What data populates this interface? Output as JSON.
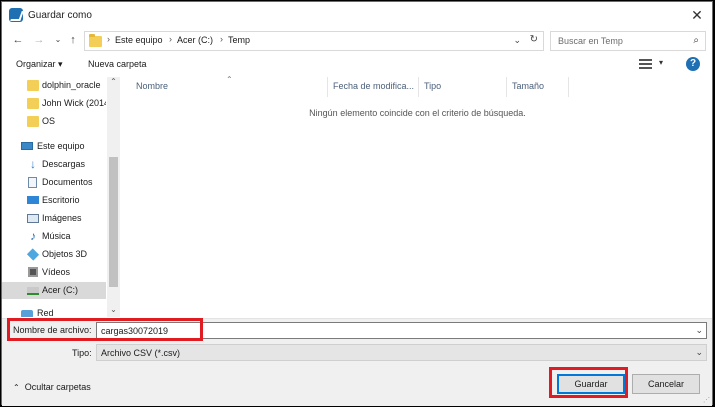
{
  "window": {
    "title": "Guardar como"
  },
  "nav": {
    "breadcrumb": [
      "Este equipo",
      "Acer (C:)",
      "Temp"
    ],
    "search_placeholder": "Buscar en Temp"
  },
  "toolbar": {
    "organize": "Organizar ▾",
    "new_folder": "Nueva carpeta",
    "help": "?"
  },
  "sidebar": {
    "items": [
      {
        "label": "dolphin_oracle",
        "icon": "folder-icon"
      },
      {
        "label": "John Wick (2014",
        "icon": "folder-icon"
      },
      {
        "label": "OS",
        "icon": "folder-icon"
      },
      {
        "label": "Este equipo",
        "icon": "computer-icon"
      },
      {
        "label": "Descargas",
        "icon": "downloads-icon"
      },
      {
        "label": "Documentos",
        "icon": "documents-icon"
      },
      {
        "label": "Escritorio",
        "icon": "desktop-icon"
      },
      {
        "label": "Imágenes",
        "icon": "pictures-icon"
      },
      {
        "label": "Música",
        "icon": "music-icon"
      },
      {
        "label": "Objetos 3D",
        "icon": "objects3d-icon"
      },
      {
        "label": "Vídeos",
        "icon": "videos-icon"
      },
      {
        "label": "Acer (C:)",
        "icon": "drive-icon"
      },
      {
        "label": "Red",
        "icon": "network-icon"
      }
    ]
  },
  "filelist": {
    "columns": [
      "Nombre",
      "Fecha de modifica...",
      "Tipo",
      "Tamaño"
    ],
    "empty_message": "Ningún elemento coincide con el criterio de búsqueda."
  },
  "form": {
    "filename_label": "Nombre de archivo:",
    "filename_value": "cargas30072019",
    "type_label": "Tipo:",
    "type_value": "Archivo CSV (*.csv)"
  },
  "footer": {
    "hide_folders": "Ocultar carpetas",
    "save": "Guardar",
    "cancel": "Cancelar"
  },
  "colors": {
    "accent": "#0078d7",
    "annotation": "#e01b22"
  }
}
